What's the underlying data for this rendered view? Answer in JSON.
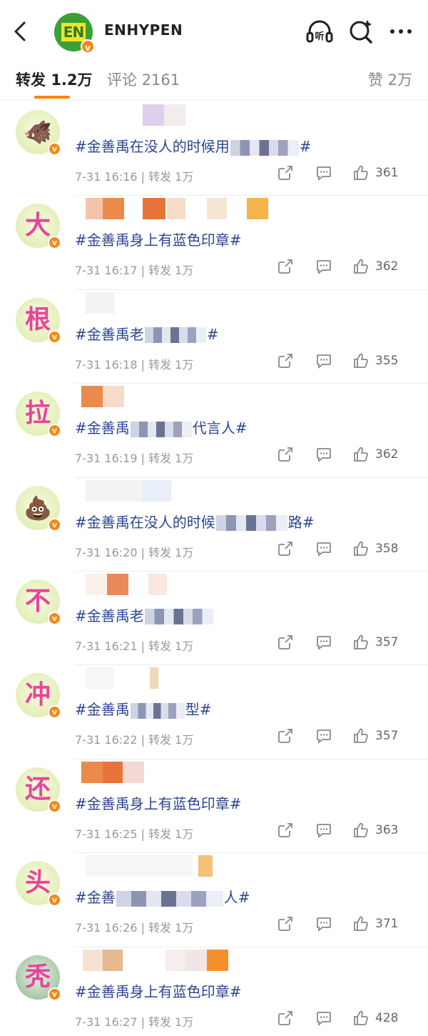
{
  "header": {
    "account_name": "ENHYPEN",
    "logo_text": "EN",
    "verified_badge": "v"
  },
  "tabs": [
    {
      "label": "转发",
      "count": "1.2万"
    },
    {
      "label": "评论",
      "count": "2161"
    },
    {
      "label": "赞",
      "count": "2万"
    }
  ],
  "colors": {
    "accent": "#ff8200",
    "topic_link": "#2b4690",
    "verified": "#f18a1a"
  },
  "items": [
    {
      "avatar": "🐗",
      "content_pre": "#金善禹在没人的时候用",
      "content_post": "#",
      "timestamp": "7-31 16:16",
      "reposts_label": "转发 1万",
      "likes": "361"
    },
    {
      "avatar": "大",
      "content_pre": "#金善禹身上有蓝色印章#",
      "content_post": "",
      "timestamp": "7-31 16:17",
      "reposts_label": "转发 1万",
      "likes": "362"
    },
    {
      "avatar": "根",
      "content_pre": "#金善禹老",
      "content_post": "#",
      "timestamp": "7-31 16:18",
      "reposts_label": "转发 1万",
      "likes": "355"
    },
    {
      "avatar": "拉",
      "content_pre": "#金善禹",
      "content_post": "代言人#",
      "timestamp": "7-31 16:19",
      "reposts_label": "转发 1万",
      "likes": "362"
    },
    {
      "avatar": "💩",
      "content_pre": "#金善禹在没人的时候",
      "content_post": "路#",
      "timestamp": "7-31 16:20",
      "reposts_label": "转发 1万",
      "likes": "358"
    },
    {
      "avatar": "不",
      "content_pre": "#金善禹老",
      "content_post": "",
      "timestamp": "7-31 16:21",
      "reposts_label": "转发 1万",
      "likes": "357"
    },
    {
      "avatar": "冲",
      "content_pre": "#金善禹",
      "content_post": "型#",
      "timestamp": "7-31 16:22",
      "reposts_label": "转发 1万",
      "likes": "357"
    },
    {
      "avatar": "还",
      "content_pre": "#金善禹身上有蓝色印章#",
      "content_post": "",
      "timestamp": "7-31 16:25",
      "reposts_label": "转发 1万",
      "likes": "363"
    },
    {
      "avatar": "头",
      "content_pre": "#金善",
      "content_post": "人#",
      "timestamp": "7-31 16:26",
      "reposts_label": "转发 1万",
      "likes": "371"
    },
    {
      "avatar": "秃",
      "content_pre": "#金善禹身上有蓝色印章#",
      "content_post": "",
      "timestamp": "7-31 16:27",
      "reposts_label": "转发 1万",
      "likes": "428"
    }
  ]
}
